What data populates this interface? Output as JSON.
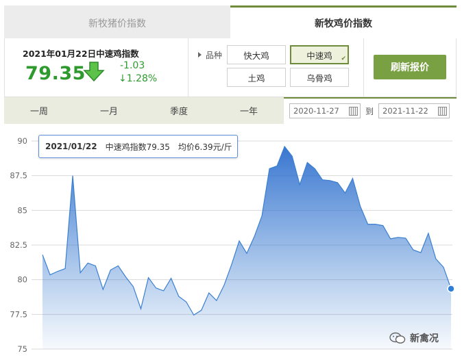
{
  "tabs": {
    "pig": "新牧猪价指数",
    "chicken": "新牧鸡价指数"
  },
  "index": {
    "title": "2021年01月22日中速鸡指数",
    "value": "79.35",
    "change_abs": "-1.03",
    "change_pct": "↓1.28%",
    "color": "#2e9a2e"
  },
  "variety": {
    "label": "品种",
    "options": [
      "快大鸡",
      "中速鸡",
      "土鸡",
      "乌骨鸡"
    ],
    "selected": "中速鸡"
  },
  "refresh_label": "刷新报价",
  "periods": [
    "一周",
    "一月",
    "季度",
    "一年"
  ],
  "date_range": {
    "start": "2020-11-27",
    "to_label": "到",
    "end": "2021-11-22"
  },
  "tooltip": {
    "date": "2021/01/22",
    "index": "中速鸡指数79.35",
    "price": "均价6.39元/斤"
  },
  "watermark": "新禽况",
  "chart_data": {
    "type": "area",
    "ylim": [
      75,
      90
    ],
    "yticks": [
      "90",
      "87.5",
      "85",
      "82.5",
      "80",
      "77.5",
      "75"
    ],
    "ytick_values": [
      90,
      87.5,
      85,
      82.5,
      80,
      77.5,
      75
    ],
    "grid": true,
    "line_color": "#3a7fd0",
    "values": [
      81.8,
      80.35,
      80.6,
      80.8,
      87.5,
      80.5,
      81.2,
      81.0,
      79.3,
      80.7,
      81.0,
      80.2,
      79.5,
      77.9,
      80.15,
      79.4,
      79.2,
      80.1,
      78.8,
      78.4,
      77.45,
      77.8,
      79.05,
      78.5,
      79.6,
      81.1,
      82.8,
      81.9,
      83.1,
      84.6,
      88.0,
      88.2,
      89.6,
      88.9,
      86.85,
      88.45,
      88.0,
      87.2,
      87.15,
      87.0,
      86.25,
      87.3,
      85.3,
      84.0,
      84.0,
      83.9,
      82.95,
      83.05,
      83.0,
      82.15,
      81.95,
      83.35,
      81.5,
      80.9,
      79.35
    ]
  }
}
